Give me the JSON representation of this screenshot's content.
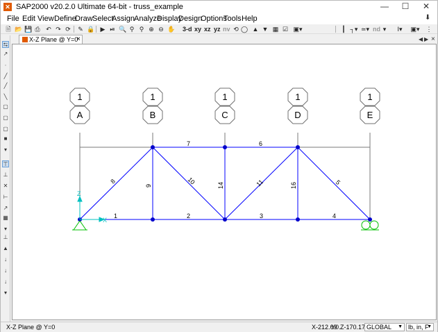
{
  "window": {
    "title": "SAP2000 v20.2.0 Ultimate 64-bit - truss_example",
    "app_icon": "sap-logo-icon"
  },
  "menu": [
    "File",
    "Edit",
    "View",
    "Define",
    "Draw",
    "Select",
    "Assign",
    "Analyze",
    "Display",
    "Design",
    "Options",
    "Tools",
    "Help"
  ],
  "toolbar": {
    "view_buttons": [
      "3-d",
      "xy",
      "xz",
      "yz",
      "nv"
    ],
    "nd_label": "nd"
  },
  "tab": {
    "label": "X-Z Plane @ Y=0"
  },
  "grids": [
    {
      "bubble_top": "1",
      "bubble_bottom": "A"
    },
    {
      "bubble_top": "1",
      "bubble_bottom": "B"
    },
    {
      "bubble_top": "1",
      "bubble_bottom": "C"
    },
    {
      "bubble_top": "1",
      "bubble_bottom": "D"
    },
    {
      "bubble_top": "1",
      "bubble_bottom": "E"
    }
  ],
  "frames": [
    {
      "label": "1"
    },
    {
      "label": "2"
    },
    {
      "label": "3"
    },
    {
      "label": "4"
    },
    {
      "label": "5"
    },
    {
      "label": "6"
    },
    {
      "label": "7"
    },
    {
      "label": "8"
    },
    {
      "label": "9"
    },
    {
      "label": "10"
    },
    {
      "label": "11"
    },
    {
      "label": "14"
    },
    {
      "label": "16"
    }
  ],
  "axes": {
    "x": "X",
    "z": "Z"
  },
  "status": {
    "view": "X-Z Plane @ Y=0",
    "x": "X-212.69",
    "y": "Y0.",
    "z": "Z-170.17",
    "coord_system": "GLOBAL",
    "units": "lb, in, F"
  },
  "colors": {
    "frame": "#0000ff",
    "joint": "#0000cc",
    "support": "#00c000",
    "grid": "#7a7a7a",
    "axis": "#00c0c0"
  }
}
